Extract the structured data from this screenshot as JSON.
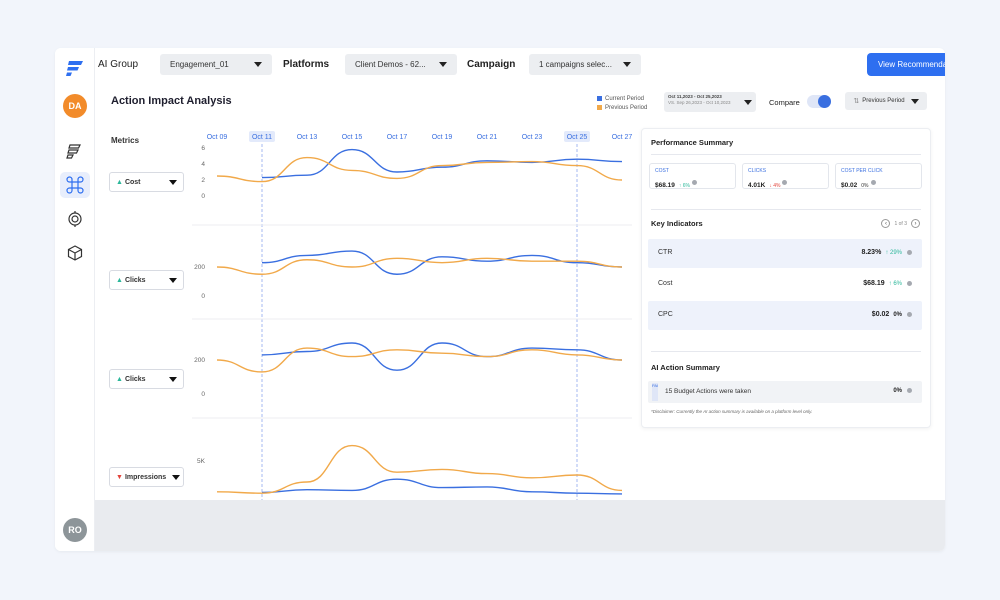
{
  "colors": {
    "accent": "#2e6ff0",
    "current_period": "#3a6fe0",
    "previous_period": "#f1a94a",
    "positive": "#2bb79a",
    "negative": "#e2433a"
  },
  "sidebar": {
    "user_initials": "DA",
    "bottom_initials": "RO",
    "icons": [
      "layers-icon",
      "command-icon",
      "loop-icon",
      "cube-icon"
    ]
  },
  "topbar": {
    "ai_group_label": "AI Group",
    "ai_group_value": "Engagement_01",
    "platforms_label": "Platforms",
    "platforms_value": "Client Demos - 62...",
    "campaign_label": "Campaign",
    "campaign_value": "1 campaigns selec...",
    "view_button": "View Recommendation"
  },
  "analysis": {
    "title": "Action Impact Analysis",
    "legend_current": "Current Period",
    "legend_previous": "Previous Period",
    "date_range_current": "Oct 11,2023 - Oct 25,2023",
    "date_range_previous": "VS. Sep 26,2023 - Oct 10,2023",
    "compare_label": "Compare",
    "compare_on": true,
    "period_select": "Previous Period",
    "metrics_label": "Metrics",
    "metric_rows": [
      {
        "label": "Cost",
        "direction": "up"
      },
      {
        "label": "Clicks",
        "direction": "up"
      },
      {
        "label": "Clicks",
        "direction": "up"
      },
      {
        "label": "Impressions",
        "direction": "down"
      }
    ]
  },
  "chart_data": {
    "type": "line",
    "x": [
      "Oct 09",
      "Oct 11",
      "Oct 13",
      "Oct 15",
      "Oct 17",
      "Oct 19",
      "Oct 21",
      "Oct 23",
      "Oct 25",
      "Oct 27"
    ],
    "highlighted_x": [
      "Oct 11",
      "Oct 25"
    ],
    "panels": [
      {
        "metric": "Cost",
        "y_ticks": [
          "6",
          "4",
          "2",
          "0"
        ],
        "ylim": [
          0,
          6
        ],
        "series": [
          {
            "name": "Current Period",
            "values": [
              null,
              2.3,
              2.6,
              5.8,
              3.0,
              3.6,
              4.4,
              4.2,
              4.6,
              4.3
            ]
          },
          {
            "name": "Previous Period",
            "values": [
              2.5,
              1.8,
              4.8,
              3.2,
              2.2,
              3.8,
              4.2,
              4.3,
              3.8,
              2.0
            ]
          }
        ]
      },
      {
        "metric": "Clicks",
        "y_ticks": [
          "200",
          "0"
        ],
        "ylim": [
          0,
          400
        ],
        "series": [
          {
            "name": "Current Period",
            "values": [
              null,
              230,
              280,
              310,
              150,
              270,
              240,
              280,
              230,
              200
            ]
          },
          {
            "name": "Previous Period",
            "values": [
              200,
              150,
              250,
              200,
              260,
              230,
              260,
              240,
              240,
              200
            ]
          }
        ]
      },
      {
        "metric": "Clicks",
        "y_ticks": [
          "200",
          "0"
        ],
        "ylim": [
          0,
          400
        ],
        "series": [
          {
            "name": "Current Period",
            "values": [
              null,
              230,
              250,
              300,
              140,
              300,
              220,
              270,
              260,
              200
            ]
          },
          {
            "name": "Previous Period",
            "values": [
              200,
              130,
              270,
              220,
              260,
              240,
              220,
              260,
              230,
              200
            ]
          }
        ]
      },
      {
        "metric": "Impressions",
        "y_ticks": [
          "5K"
        ],
        "ylim": [
          0,
          10000
        ],
        "series": [
          {
            "name": "Current Period",
            "values": [
              null,
              500,
              900,
              800,
              2400,
              1200,
              1300,
              600,
              400,
              300
            ]
          },
          {
            "name": "Previous Period",
            "values": [
              600,
              400,
              2000,
              7200,
              3400,
              3800,
              3200,
              2600,
              3000,
              800
            ]
          }
        ]
      }
    ]
  },
  "performance": {
    "title": "Performance Summary",
    "cost": {
      "label": "COST",
      "value": "$68.19",
      "change": "6%",
      "dir": "up"
    },
    "clicks": {
      "label": "CLICKS",
      "value": "4.01K",
      "change": "4%",
      "dir": "down"
    },
    "cpc": {
      "label": "COST PER CLICK",
      "value": "$0.02",
      "change": "0%",
      "dir": "neutral"
    },
    "key_indicators_title": "Key Indicators",
    "pager_text": "1 of 3",
    "indicators": [
      {
        "name": "CTR",
        "value": "8.23%",
        "change": "29%",
        "dir": "up"
      },
      {
        "name": "Cost",
        "value": "$68.19",
        "change": "6%",
        "dir": "up"
      },
      {
        "name": "CPC",
        "value": "$0.02",
        "change": "0%",
        "dir": "neutral"
      }
    ],
    "ai_summary_title": "AI Action Summary",
    "ai_badge": "PAI",
    "ai_action_text": "15 Budget Actions were taken",
    "ai_action_value": "0%",
    "disclaimer": "*Disclaimer: Currently the AI action summary is available on a platform level only."
  }
}
